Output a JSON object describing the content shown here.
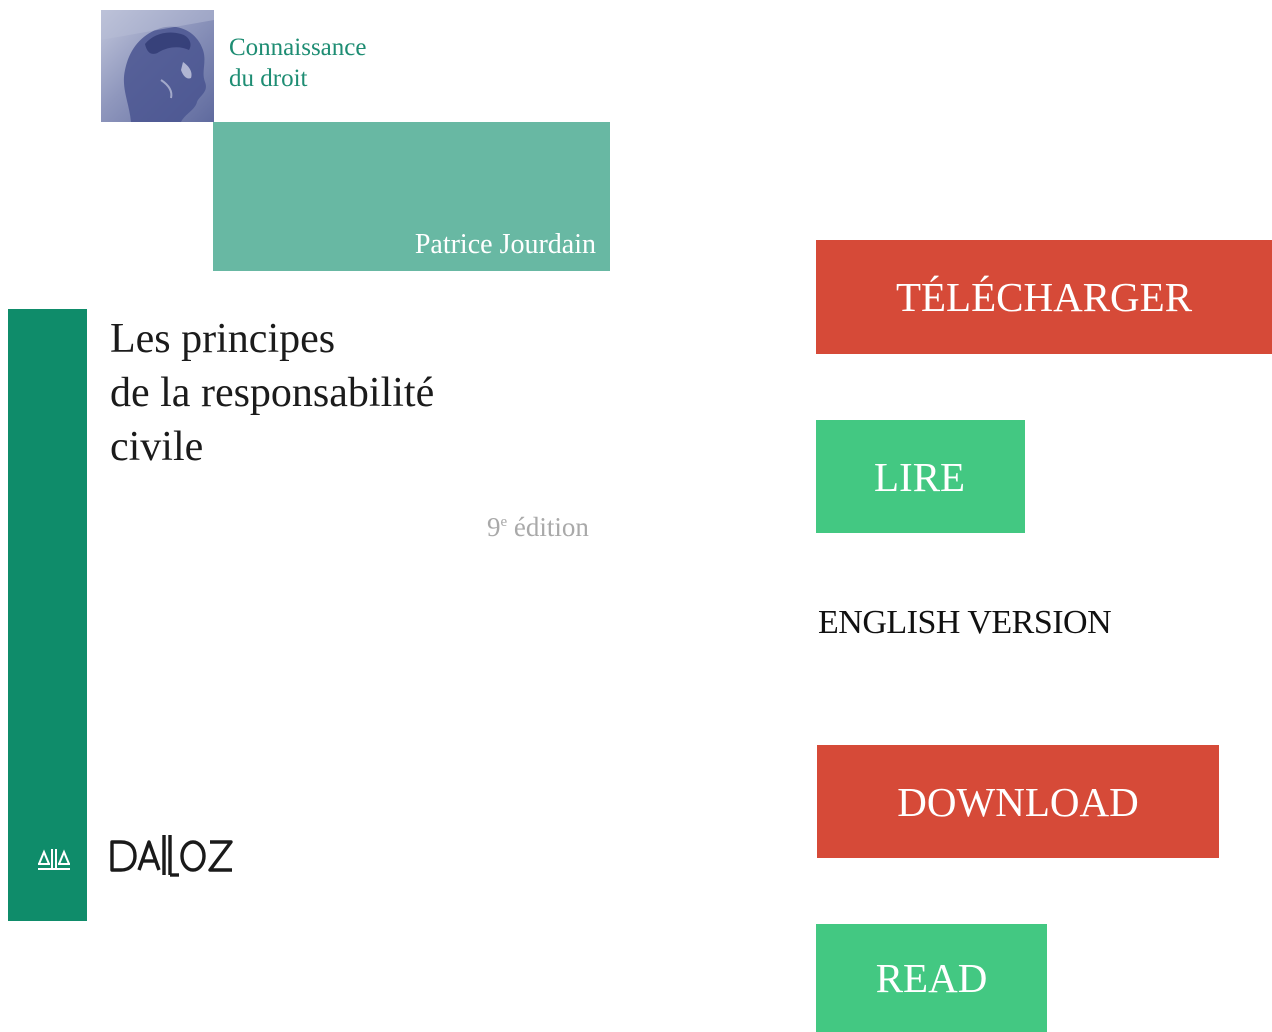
{
  "cover": {
    "series_line1": "Connaissance",
    "series_line2": "du droit",
    "author": "Patrice Jourdain",
    "title_line1": "Les principes",
    "title_line2": "de la responsabilité",
    "title_line3": "civile",
    "edition_number": "9",
    "edition_suffix": "e",
    "edition_word": "édition",
    "publisher": "DALLOZ"
  },
  "actions": {
    "download_fr": "TÉLÉCHARGER",
    "read_fr": "LIRE",
    "language_label": "ENGLISH VERSION",
    "download_en": "DOWNLOAD",
    "read_en": "READ"
  },
  "colors": {
    "download_button": "#d64a38",
    "read_button": "#43c882",
    "cover_spine": "#0f8c6a",
    "cover_author_block": "#68b8a3",
    "series_text": "#1e8d73"
  },
  "icons": {
    "portrait": "classical-bust-image",
    "publisher_mark": "scales-icon"
  }
}
